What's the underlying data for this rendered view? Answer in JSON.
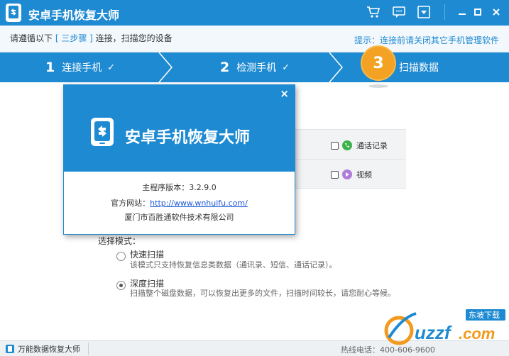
{
  "titlebar": {
    "title": "安卓手机恢复大师",
    "icons": [
      "cart-icon",
      "chat-icon",
      "dropdown-icon"
    ],
    "controls": [
      "minimize-icon",
      "maximize-icon",
      "close-icon"
    ],
    "color": "#1e8ad2"
  },
  "instruction": {
    "prefix": "请遵循以下",
    "steps_label": "[ 三步骤 ]",
    "suffix": "连接，扫描您的设备",
    "hint": "提示：连接前请关闭其它手机管理软件"
  },
  "steps": [
    {
      "num": "1",
      "label": "连接手机",
      "check": "✓"
    },
    {
      "num": "2",
      "label": "检测手机",
      "check": "✓"
    },
    {
      "num": "3",
      "label": "扫描数据"
    }
  ],
  "data_types": [
    {
      "label": "通话记录",
      "icon": "phone-icon",
      "color": "#3bb34a"
    },
    {
      "label": "视频",
      "icon": "video-icon",
      "color": "#b07bd8"
    }
  ],
  "scan_mode": {
    "title": "选择模式：",
    "options": [
      {
        "name": "快速扫描",
        "desc": "该模式只支持恢复信息类数据（通讯录、短信、通话记录）。",
        "selected": false
      },
      {
        "name": "深度扫描",
        "desc": "扫描整个磁盘数据，可以恢复出更多的文件，扫描时间较长，请您耐心等候。",
        "selected": true
      }
    ]
  },
  "statusbar": {
    "left": "万能数据恢复大师",
    "right": "热线电话：400-606-9600"
  },
  "about_dialog": {
    "title": "安卓手机恢复大师",
    "version": "主程序版本：3.2.9.0",
    "website_label": "官方网站：",
    "website_url": "http://www.wnhuifu.com/",
    "company": "厦门市百胜通软件技术有限公司",
    "close": "×"
  },
  "watermark": {
    "brand": "uzzf.com",
    "tag": "东坡下载"
  }
}
